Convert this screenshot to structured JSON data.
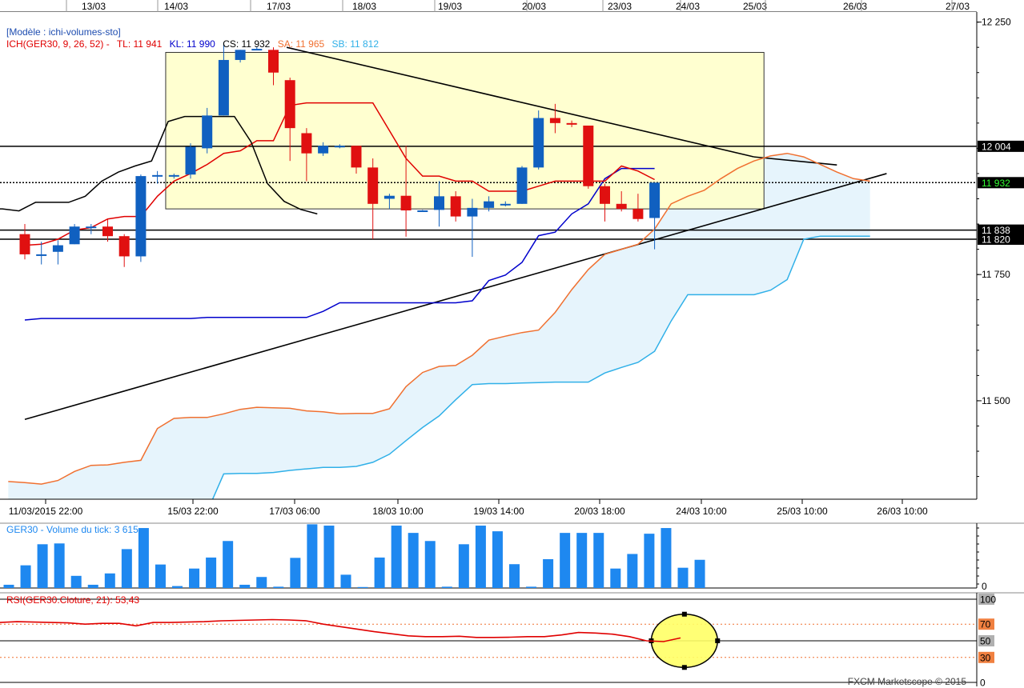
{
  "header": {
    "model": "[Modèle : ichi-volumes-sto]",
    "ich_label": "ICH(GER30, 9, 26, 52) -",
    "tl": "TL: 11 941",
    "kl": "KL: 11 990",
    "cs": "CS: 11 932",
    "sa": "SA: 11 965",
    "sb": "SB: 11 812"
  },
  "volume_header": "GER30 - Volume du tick: 3 615",
  "rsi_header": "RSI(GER30.Cloture, 21): 53,43",
  "footer": "FXCM Marketscope © 2015",
  "colors": {
    "tenkan": "#e00000",
    "kijun": "#0000cc",
    "chikou": "#000000",
    "senkou_a": "#f07030",
    "senkou_b": "#30b0e8",
    "cloud": "#e6f4fc",
    "bull": "#1060c0",
    "bear": "#e01010",
    "volume": "#1e88f0",
    "rsi": "#e00000",
    "box": "#ffffc8"
  },
  "chart_data": [
    {
      "type": "candlestick",
      "name": "price",
      "top_dates": [
        "13/03",
        "14/03",
        "17/03",
        "18/03",
        "19/03",
        "20/03",
        "23/03",
        "24/03",
        "25/03",
        "26/03",
        "27/03"
      ],
      "bottom_dates": [
        "11/03/2015 22:00",
        "15/03 22:00",
        "17/03 06:00",
        "18/03 10:00",
        "19/03 14:00",
        "20/03 18:00",
        "24/03 10:00",
        "25/03 10:00",
        "26/03 10:00"
      ],
      "y_ticks": [
        {
          "value": 12250,
          "label": "12 250"
        },
        {
          "value": 11750,
          "label": "11 750"
        },
        {
          "value": 11500,
          "label": "11 500"
        }
      ],
      "ylim": [
        11305,
        12270
      ],
      "price_labels": [
        {
          "value": 12004,
          "label": "12 004",
          "style": "black"
        },
        {
          "value": 11932,
          "label": "11 932",
          "style": "green"
        },
        {
          "value": 11838,
          "label": "11 838",
          "style": "black"
        },
        {
          "value": 11820,
          "label": "11 820",
          "style": "black"
        }
      ],
      "candles": [
        {
          "o": 11830,
          "h": 11850,
          "l": 11780,
          "c": 11790
        },
        {
          "o": 11790,
          "h": 11815,
          "l": 11770,
          "c": 11790
        },
        {
          "o": 11795,
          "h": 11818,
          "l": 11770,
          "c": 11808
        },
        {
          "o": 11810,
          "h": 11850,
          "l": 11810,
          "c": 11845
        },
        {
          "o": 11845,
          "h": 11850,
          "l": 11830,
          "c": 11845
        },
        {
          "o": 11845,
          "h": 11860,
          "l": 11815,
          "c": 11826
        },
        {
          "o": 11826,
          "h": 11830,
          "l": 11765,
          "c": 11786
        },
        {
          "o": 11786,
          "h": 11948,
          "l": 11775,
          "c": 11945
        },
        {
          "o": 11945,
          "h": 11955,
          "l": 11930,
          "c": 11947
        },
        {
          "o": 11947,
          "h": 11950,
          "l": 11940,
          "c": 11947
        },
        {
          "o": 11948,
          "h": 12010,
          "l": 11940,
          "c": 12003
        },
        {
          "o": 12000,
          "h": 12080,
          "l": 11990,
          "c": 12065
        },
        {
          "o": 12065,
          "h": 12210,
          "l": 12065,
          "c": 12175
        },
        {
          "o": 12175,
          "h": 12195,
          "l": 12170,
          "c": 12195
        },
        {
          "o": 12195,
          "h": 12200,
          "l": 12195,
          "c": 12197
        },
        {
          "o": 12195,
          "h": 12200,
          "l": 12125,
          "c": 12150
        },
        {
          "o": 12135,
          "h": 12140,
          "l": 11975,
          "c": 12040
        },
        {
          "o": 12030,
          "h": 12040,
          "l": 11935,
          "c": 11990
        },
        {
          "o": 11990,
          "h": 12012,
          "l": 11985,
          "c": 12005
        },
        {
          "o": 12005,
          "h": 12008,
          "l": 12000,
          "c": 12005
        },
        {
          "o": 12005,
          "h": 12005,
          "l": 11950,
          "c": 11962
        },
        {
          "o": 11962,
          "h": 11980,
          "l": 11820,
          "c": 11890
        },
        {
          "o": 11900,
          "h": 11910,
          "l": 11880,
          "c": 11906
        },
        {
          "o": 11906,
          "h": 12005,
          "l": 11825,
          "c": 11877
        },
        {
          "o": 11877,
          "h": 11878,
          "l": 11875,
          "c": 11877
        },
        {
          "o": 11878,
          "h": 11935,
          "l": 11845,
          "c": 11905
        },
        {
          "o": 11905,
          "h": 11915,
          "l": 11855,
          "c": 11865
        },
        {
          "o": 11865,
          "h": 11900,
          "l": 11785,
          "c": 11882
        },
        {
          "o": 11882,
          "h": 11905,
          "l": 11875,
          "c": 11895
        },
        {
          "o": 11890,
          "h": 11895,
          "l": 11885,
          "c": 11890
        },
        {
          "o": 11890,
          "h": 11965,
          "l": 11890,
          "c": 11962
        },
        {
          "o": 11962,
          "h": 12075,
          "l": 11958,
          "c": 12060
        },
        {
          "o": 12060,
          "h": 12088,
          "l": 12030,
          "c": 12050
        },
        {
          "o": 12050,
          "h": 12055,
          "l": 12042,
          "c": 12047
        },
        {
          "o": 12045,
          "h": 12045,
          "l": 11920,
          "c": 11925
        },
        {
          "o": 11925,
          "h": 11930,
          "l": 11855,
          "c": 11890
        },
        {
          "o": 11890,
          "h": 11915,
          "l": 11875,
          "c": 11880
        },
        {
          "o": 11880,
          "h": 11910,
          "l": 11855,
          "c": 11860
        },
        {
          "o": 11862,
          "h": 11932,
          "l": 11800,
          "c": 11932
        }
      ],
      "tenkan": [
        11808,
        11810,
        11820,
        11838,
        11843,
        11860,
        11865,
        11865,
        11905,
        11935,
        11950,
        11968,
        11990,
        11995,
        12015,
        12015,
        12085,
        12090,
        12090,
        12090,
        12090,
        12090,
        12035,
        11980,
        11945,
        11945,
        11935,
        11935,
        11915,
        11915,
        11915,
        11925,
        11935,
        11935,
        11935,
        11935,
        11965,
        11955,
        11938
      ],
      "kijun": [
        11660,
        11663,
        11663,
        11663,
        11663,
        11663,
        11663,
        11663,
        11663,
        11663,
        11663,
        11665,
        11665,
        11665,
        11665,
        11665,
        11665,
        11665,
        11677,
        11694,
        11694,
        11694,
        11694,
        11694,
        11694,
        11694,
        11694,
        11698,
        11738,
        11749,
        11774,
        11827,
        11834,
        11870,
        11890,
        11940,
        11960,
        11960,
        11960
      ],
      "chikou": [
        11880,
        11876,
        11893,
        11893,
        11893,
        11905,
        11935,
        11953,
        11965,
        11975,
        12053,
        12063,
        12063,
        12063,
        12063,
        12013,
        11930,
        11895,
        11879,
        11870
      ],
      "chikou_start": 0,
      "senkou_a": [
        11340,
        11338,
        11335,
        11342,
        11360,
        11372,
        11373,
        11378,
        11382,
        11445,
        11465,
        11467,
        11467,
        11474,
        11483,
        11487,
        11486,
        11485,
        11480,
        11478,
        11474,
        11475,
        11475,
        11484,
        11528,
        11556,
        11568,
        11570,
        11590,
        11620,
        11628,
        11635,
        11640,
        11675,
        11720,
        11760,
        11790,
        11800,
        11810,
        11840,
        11890,
        11905,
        11917,
        11940,
        11960,
        11975,
        11985,
        11990,
        11983,
        11968,
        11953,
        11940,
        11935
      ],
      "senkou_b": [
        11280,
        11280,
        11280,
        11280,
        11280,
        11280,
        11280,
        11280,
        11280,
        11280,
        11280,
        11280,
        11280,
        11355,
        11356,
        11356,
        11358,
        11362,
        11365,
        11368,
        11368,
        11370,
        11378,
        11394,
        11421,
        11447,
        11470,
        11502,
        11532,
        11534,
        11534,
        11535,
        11536,
        11537,
        11537,
        11537,
        11555,
        11566,
        11576,
        11598,
        11658,
        11710,
        11710,
        11710,
        11710,
        11710,
        11719,
        11740,
        11820,
        11826,
        11826,
        11826,
        11826
      ],
      "trend_lines": [
        {
          "from": [
            0,
            11463
          ],
          "to": [
            52,
            11950
          ]
        },
        {
          "from": [
            15.8,
            12200
          ],
          "to": [
            44,
            11983
          ]
        },
        {
          "from": [
            44,
            11983
          ],
          "to": [
            49,
            11967
          ]
        }
      ],
      "horizontal_lines": [
        {
          "value": 12004,
          "style": "solid"
        },
        {
          "value": 11932,
          "style": "dotted"
        },
        {
          "value": 11838,
          "style": "solid"
        },
        {
          "value": 11820,
          "style": "solid"
        }
      ],
      "highlight_box": {
        "from": 8.5,
        "to": 44.6,
        "top": 12190,
        "bottom": 11880
      }
    },
    {
      "type": "bar",
      "name": "GER30 - Volume du tick",
      "y_ticks": [
        {
          "value": 0,
          "label": "0"
        }
      ],
      "ylim": [
        0,
        3900
      ],
      "values": [
        200,
        1400,
        2700,
        2750,
        750,
        200,
        900,
        2400,
        3700,
        1450,
        120,
        1200,
        1880,
        2900,
        200,
        680,
        80,
        1860,
        3930,
        3850,
        820,
        60,
        1880,
        3850,
        3400,
        2900,
        80,
        2700,
        3850,
        3500,
        1470,
        80,
        1780,
        3400,
        3400,
        3400,
        1200,
        2100,
        3350,
        3700,
        1250,
        1740
      ]
    },
    {
      "type": "line",
      "name": "RSI",
      "y_ticks": [
        {
          "value": 100,
          "label": "100"
        },
        {
          "value": 70,
          "label": "70"
        },
        {
          "value": 50,
          "label": "50"
        },
        {
          "value": 30,
          "label": "30"
        },
        {
          "value": 0,
          "label": "0"
        }
      ],
      "ylim": [
        0,
        100
      ],
      "levels": [
        70,
        50,
        30
      ],
      "values": [
        72,
        73,
        72.5,
        72,
        71.5,
        70,
        71,
        71,
        68,
        72,
        72,
        72.5,
        73,
        74,
        74.5,
        75,
        75.5,
        75,
        74,
        70,
        67,
        64,
        61,
        58.5,
        56,
        55,
        55,
        55.5,
        54,
        54,
        54.3,
        55,
        55,
        57,
        60,
        59.3,
        58,
        55,
        50,
        49,
        53.43
      ]
    },
    {
      "type": "annotation",
      "name": "rsi-ellipse",
      "x_index": 39.8,
      "value": 50,
      "rx_index": 2,
      "ry_value": 32
    }
  ]
}
